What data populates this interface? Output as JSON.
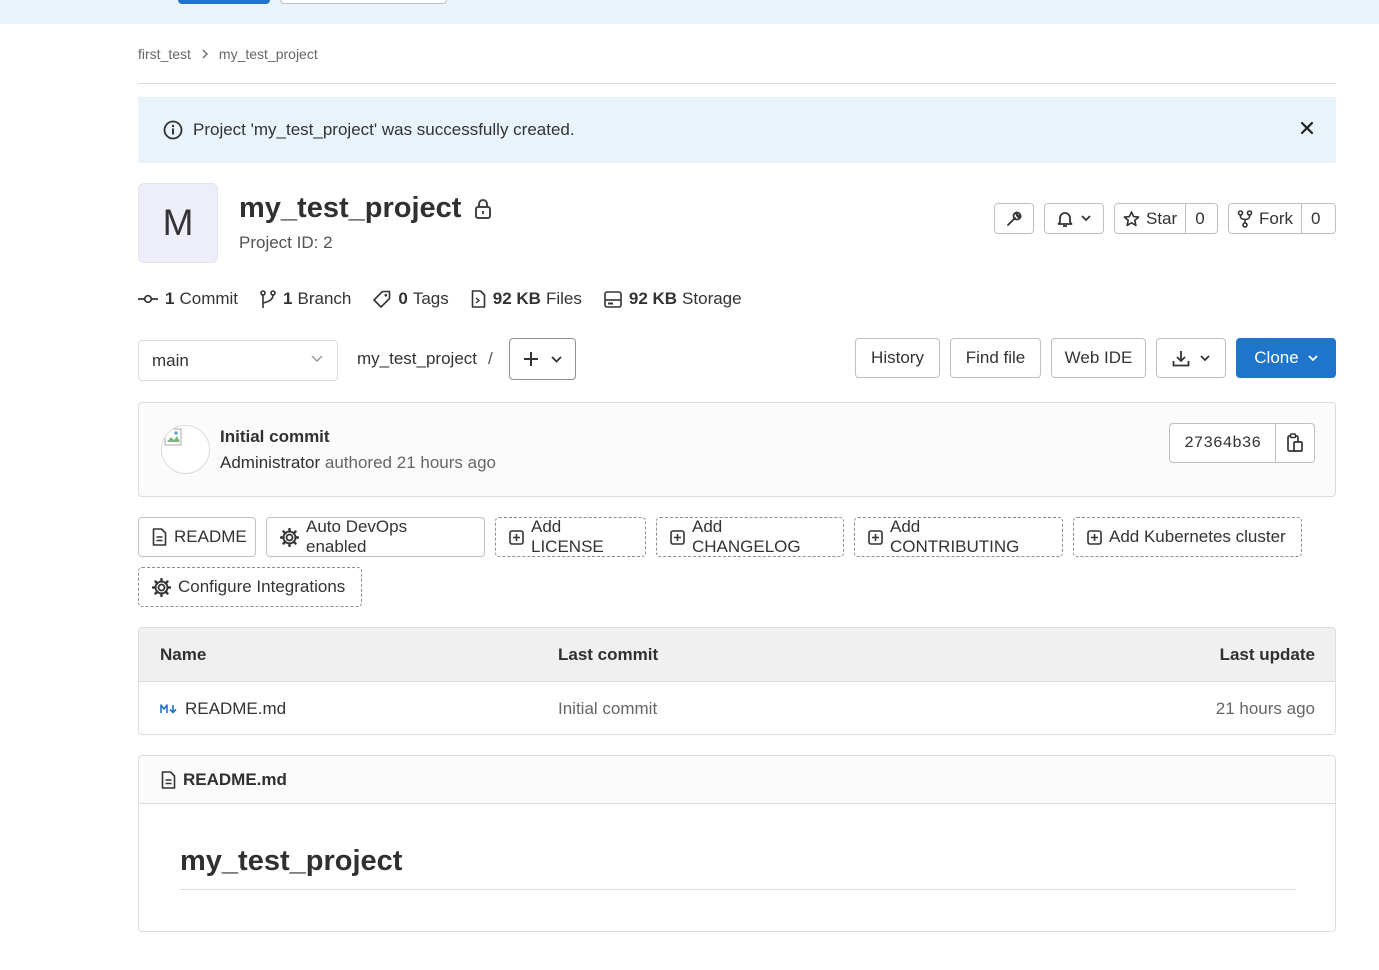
{
  "breadcrumb": {
    "group": "first_test",
    "project": "my_test_project"
  },
  "alert": {
    "message": "Project 'my_test_project' was successfully created."
  },
  "project": {
    "avatar_letter": "M",
    "name": "my_test_project",
    "id_label": "Project ID: 2"
  },
  "header_actions": {
    "star_label": "Star",
    "star_count": "0",
    "fork_label": "Fork",
    "fork_count": "0"
  },
  "stats": [
    {
      "icon": "commit-icon",
      "value": "1",
      "label": "Commit"
    },
    {
      "icon": "branch-icon",
      "value": "1",
      "label": "Branch"
    },
    {
      "icon": "tag-icon",
      "value": "0",
      "label": "Tags"
    },
    {
      "icon": "file-icon",
      "value": "92 KB",
      "label": "Files"
    },
    {
      "icon": "storage-icon",
      "value": "92 KB",
      "label": "Storage"
    }
  ],
  "repo_toolbar": {
    "branch": "main",
    "path": "my_test_project",
    "path_sep": "/",
    "history": "History",
    "find_file": "Find file",
    "web_ide": "Web IDE",
    "clone": "Clone"
  },
  "last_commit": {
    "title": "Initial commit",
    "author": "Administrator",
    "authored": "authored",
    "time": "21 hours ago",
    "sha": "27364b36"
  },
  "quick_actions": {
    "readme": "README",
    "auto_devops": "Auto DevOps enabled",
    "add_license": "Add LICENSE",
    "add_changelog": "Add CHANGELOG",
    "add_contributing": "Add CONTRIBUTING",
    "add_k8s": "Add Kubernetes cluster",
    "configure_integrations": "Configure Integrations"
  },
  "file_table": {
    "columns": {
      "name": "Name",
      "last_commit": "Last commit",
      "last_update": "Last update"
    },
    "rows": [
      {
        "name": "README.md",
        "last_commit": "Initial commit",
        "last_update": "21 hours ago"
      }
    ]
  },
  "readme": {
    "filename": "README.md",
    "heading": "my_test_project"
  },
  "colors": {
    "primary": "#1f75cb",
    "alert_bg": "#e9f3fc",
    "avatar_bg": "#eeeefb"
  }
}
